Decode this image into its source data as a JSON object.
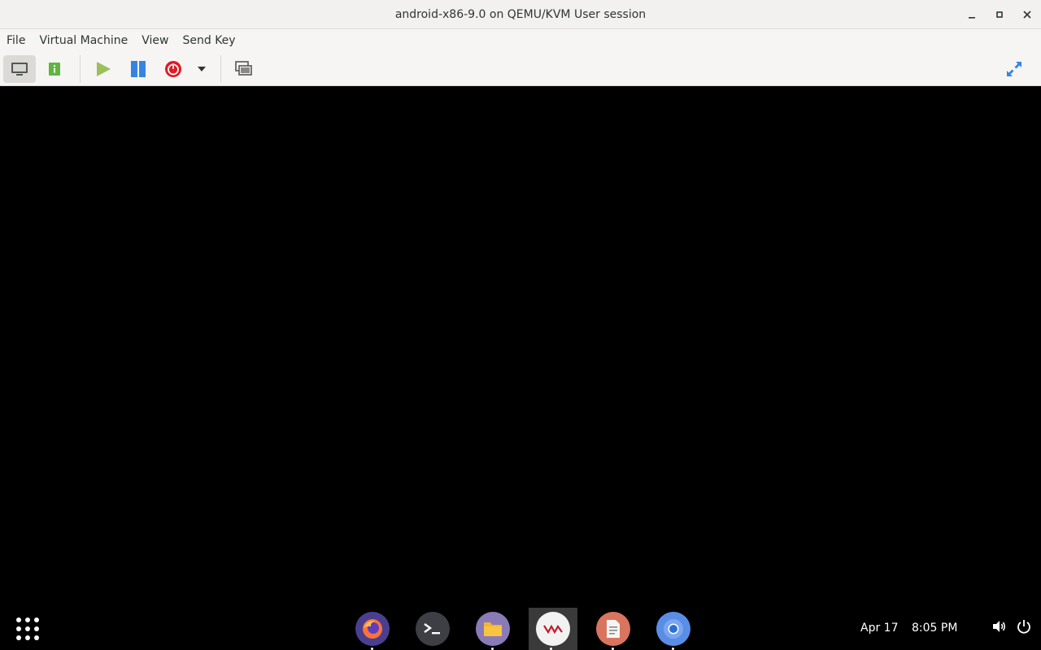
{
  "window": {
    "title": "android-x86-9.0 on QEMU/KVM User session",
    "controls": [
      "minimize-icon",
      "maximize-icon",
      "close-icon"
    ]
  },
  "menubar": {
    "items": [
      {
        "label": "File"
      },
      {
        "label": "Virtual Machine"
      },
      {
        "label": "View"
      },
      {
        "label": "Send Key"
      }
    ]
  },
  "toolbar": {
    "buttons": [
      {
        "icon": "monitor-icon",
        "active": true
      },
      {
        "icon": "details-icon"
      },
      {
        "icon": "run-icon"
      },
      {
        "icon": "pause-icon"
      },
      {
        "icon": "shutdown-icon"
      },
      {
        "icon": "shutdown-menu-chevron-icon"
      },
      {
        "icon": "snapshots-icon"
      },
      {
        "icon": "fullscreen-icon"
      }
    ]
  },
  "taskbar": {
    "apps": [
      {
        "name": "firefox",
        "icon": "firefox-icon"
      },
      {
        "name": "terminal",
        "icon": "terminal-icon"
      },
      {
        "name": "files",
        "icon": "files-icon"
      },
      {
        "name": "virt-manager",
        "icon": "virt-manager-icon",
        "active": true
      },
      {
        "name": "text-editor",
        "icon": "text-editor-icon"
      },
      {
        "name": "chromium",
        "icon": "chromium-icon"
      }
    ],
    "date": "Apr 17",
    "time": "8:05 PM",
    "tray": [
      "volume-icon",
      "power-icon"
    ]
  },
  "colors": {
    "run": "#9cbf5a",
    "pause": "#3584e4",
    "shutdown": "#e01b24",
    "details": "#5fb53f"
  }
}
